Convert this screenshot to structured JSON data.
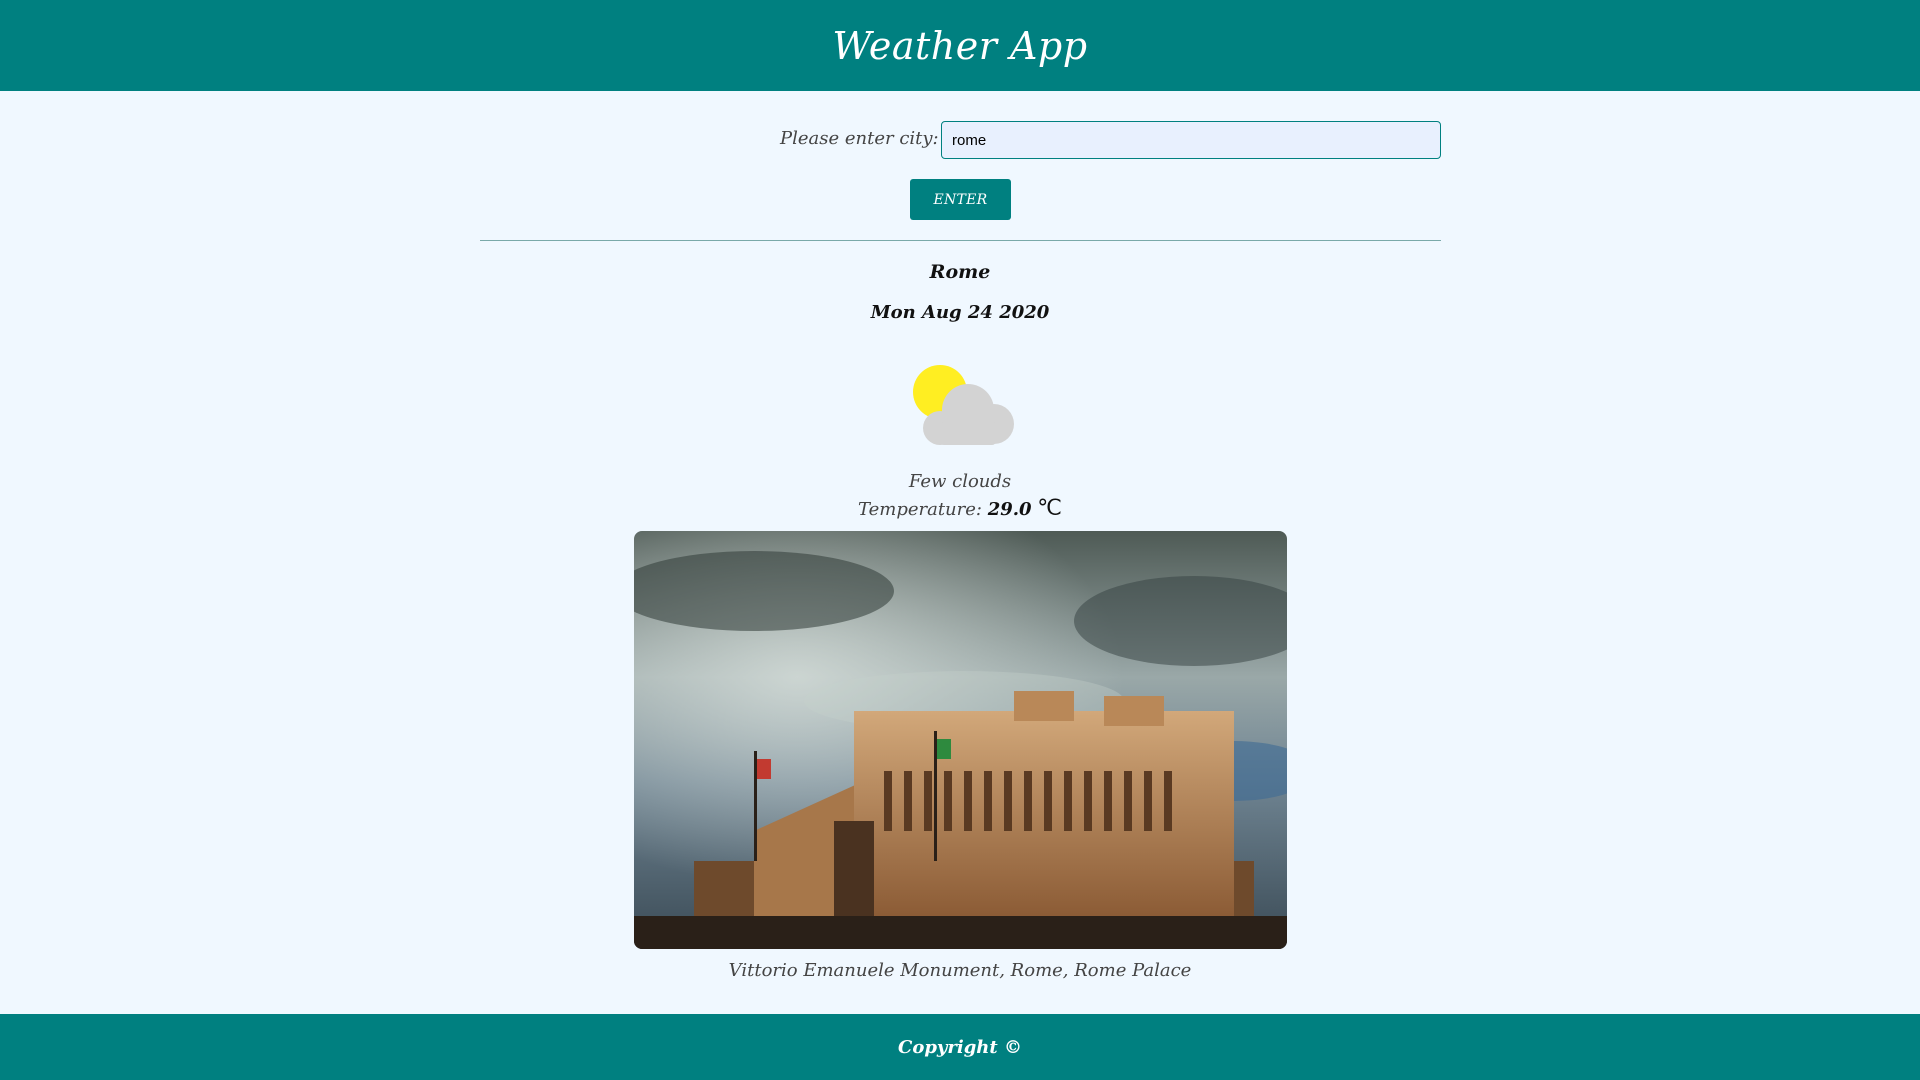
{
  "app": {
    "title": "Weather App"
  },
  "search": {
    "label": "Please enter city:",
    "value": "rome",
    "button_label": "ENTER"
  },
  "result": {
    "city": "Rome",
    "date": "Mon Aug 24 2020",
    "icon": "partly-cloudy-icon",
    "description": "Few clouds",
    "temperature_label": "Temperature:",
    "temperature_value": "29.0",
    "temperature_unit": "℃"
  },
  "photo": {
    "caption": "Vittorio Emanuele Monument, Rome, Rome Palace"
  },
  "footer": {
    "text": "Copyright ©"
  },
  "colors": {
    "accent": "#008080",
    "background": "#f0f8ff",
    "sun": "#ffee22",
    "cloud": "#d3d3d3"
  }
}
